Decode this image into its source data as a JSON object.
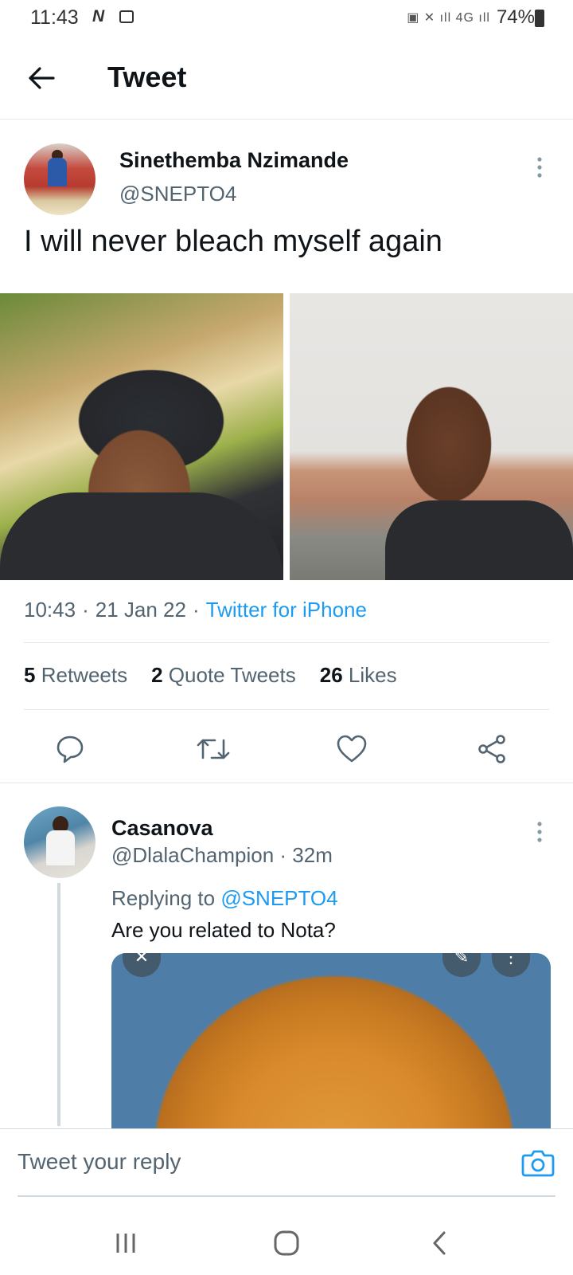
{
  "status_bar": {
    "time": "11:43",
    "battery": "74%"
  },
  "header": {
    "title": "Tweet"
  },
  "tweet": {
    "author_name": "Sinethemba Nzimande",
    "author_handle": "@SNEPTO4",
    "text": "I will never bleach myself again",
    "time": "10:43",
    "date": "21 Jan 22",
    "source": "Twitter for iPhone",
    "separator": "·",
    "stats": {
      "retweets_count": "5",
      "retweets_label": "Retweets",
      "quotes_count": "2",
      "quotes_label": "Quote Tweets",
      "likes_count": "26",
      "likes_label": "Likes"
    }
  },
  "reply": {
    "author_name": "Casanova",
    "author_handle": "@DlalaChampion",
    "age": "32m",
    "replying_prefix": "Replying to",
    "replying_to": "@SNEPTO4",
    "text": "Are you related to Nota?"
  },
  "compose": {
    "placeholder": "Tweet your reply"
  },
  "colors": {
    "accent": "#1d9bf0",
    "secondary_text": "#536471",
    "primary_text": "#0f1419"
  }
}
